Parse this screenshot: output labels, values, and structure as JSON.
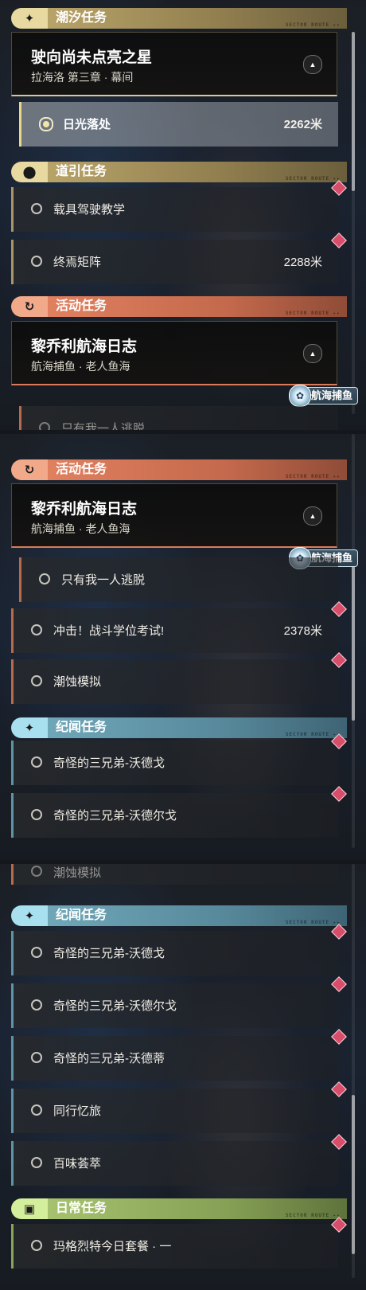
{
  "categories": {
    "tide": {
      "label": "潮汐任务",
      "icon": "sparkle-icon",
      "color": "#e8d9a0"
    },
    "guide": {
      "label": "道引任务",
      "icon": "location-pin-icon",
      "color": "#e8d9a0"
    },
    "event": {
      "label": "活动任务",
      "icon": "refresh-icon",
      "color": "#f2a98a"
    },
    "chronicle": {
      "label": "纪闻任务",
      "icon": "sparkle-icon",
      "color": "#a9e0f0"
    },
    "daily": {
      "label": "日常任务",
      "icon": "alert-icon",
      "color": "#d4ef9c"
    },
    "deco_text": "SECTOR  ROUTE  ▸▸"
  },
  "features": {
    "star": {
      "title": "驶向尚未点亮之星",
      "subtitle": "拉海洛 第三章 · 幕间"
    },
    "voyage": {
      "title": "黎乔利航海日志",
      "subtitle": "航海捕鱼 · 老人鱼海",
      "badge": "航海捕鱼"
    }
  },
  "tasks": {
    "sunlight": {
      "label": "日光落处",
      "distance": "2262米"
    },
    "driving": {
      "label": "载具驾驶教学"
    },
    "matrix": {
      "label": "终焉矩阵",
      "distance": "2288米"
    },
    "escape": {
      "label": "只有我一人逃脱"
    },
    "exam": {
      "label": "冲击！战斗学位考试!",
      "distance": "2378米"
    },
    "erosion": {
      "label": "潮蚀模拟"
    },
    "brothers1": {
      "label": "奇怪的三兄弟-沃德戈"
    },
    "brothers2": {
      "label": "奇怪的三兄弟-沃德尔戈"
    },
    "brothers3": {
      "label": "奇怪的三兄弟-沃德蒂"
    },
    "memory": {
      "label": "同行忆旅"
    },
    "flavor": {
      "label": "百味荟萃"
    },
    "meal": {
      "label": "玛格烈特今日套餐 · 一"
    }
  }
}
